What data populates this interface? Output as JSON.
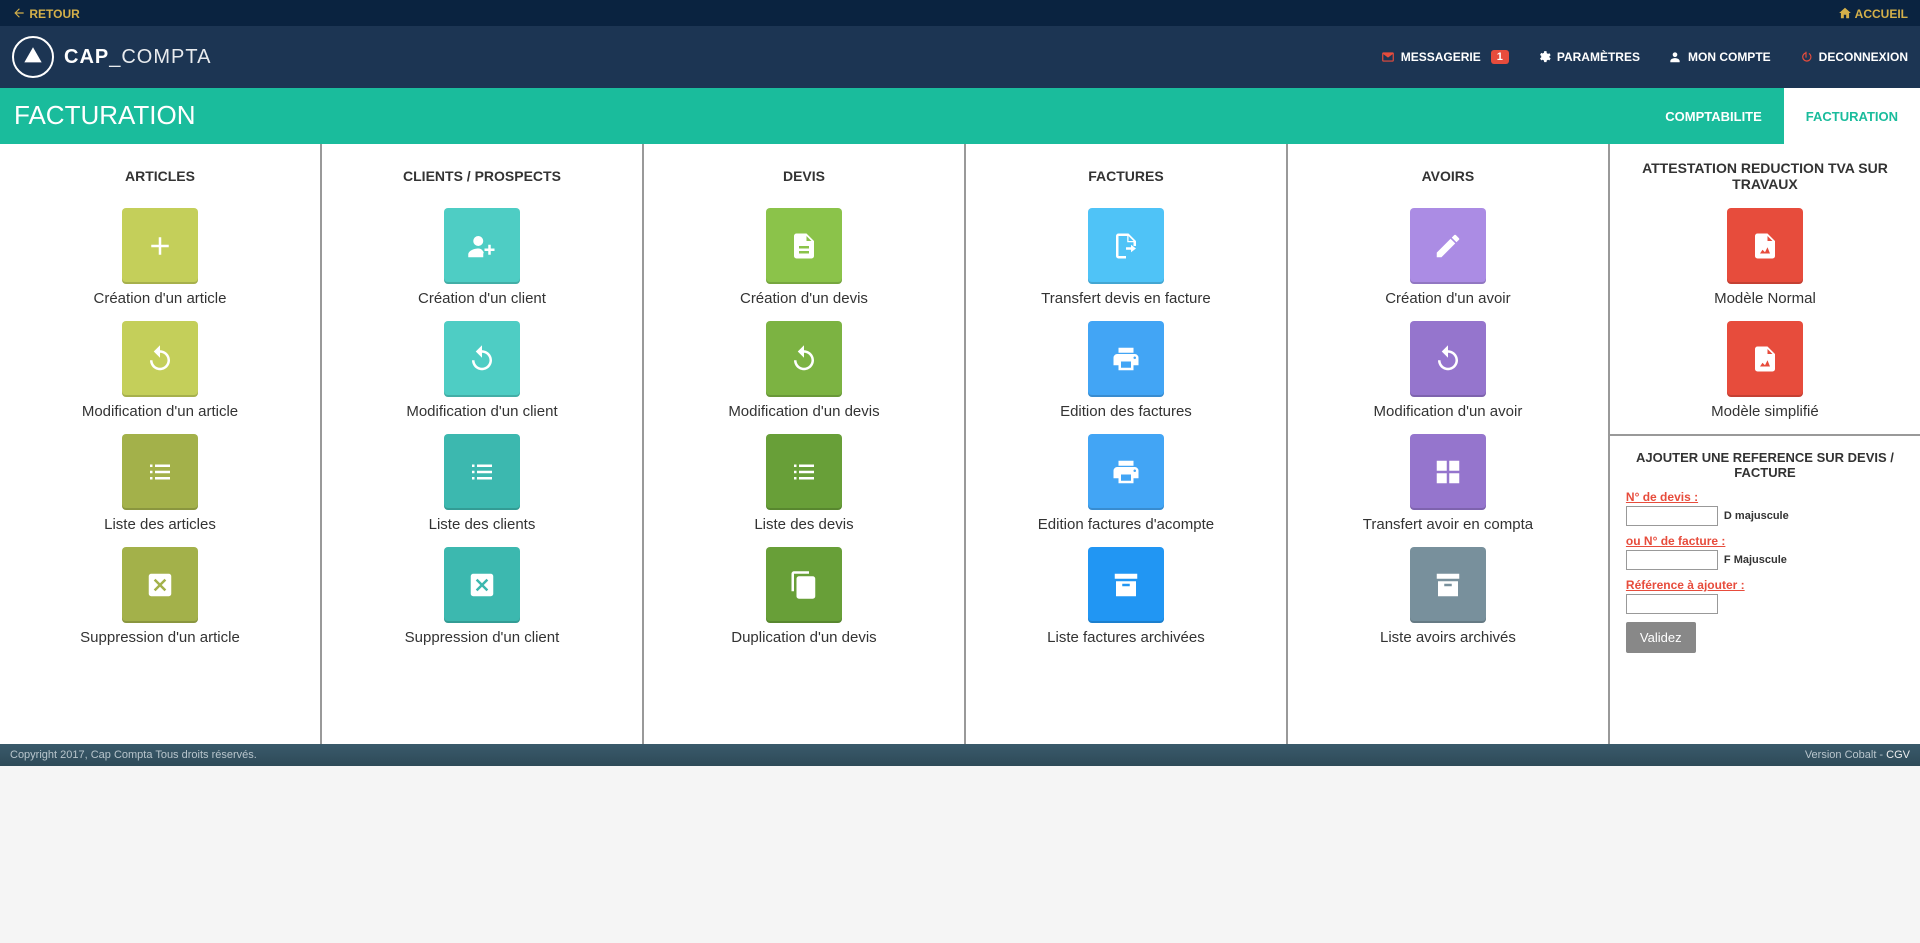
{
  "topbar": {
    "retour": "RETOUR",
    "accueil": "ACCUEIL"
  },
  "brand": {
    "bold": "CAP",
    "light": "_COMPTA"
  },
  "nav": {
    "messagerie": "MESSAGERIE",
    "messagerie_badge": "1",
    "parametres": "PARAMÈTRES",
    "mon_compte": "MON COMPTE",
    "deconnexion": "DECONNEXION"
  },
  "greenbar": {
    "title": "FACTURATION",
    "tab_compta": "COMPTABILITE",
    "tab_fact": "FACTURATION"
  },
  "columns": {
    "articles": {
      "title": "ARTICLES",
      "create": "Création d'un article",
      "modify": "Modification d'un article",
      "list": "Liste des articles",
      "delete": "Suppression d'un article"
    },
    "clients": {
      "title": "CLIENTS / PROSPECTS",
      "create": "Création d'un client",
      "modify": "Modification d'un client",
      "list": "Liste des clients",
      "delete": "Suppression d'un client"
    },
    "devis": {
      "title": "DEVIS",
      "create": "Création d'un devis",
      "modify": "Modification d'un devis",
      "list": "Liste des devis",
      "dup": "Duplication d'un devis"
    },
    "factures": {
      "title": "FACTURES",
      "transfer": "Transfert devis en facture",
      "edit": "Edition des factures",
      "acompte": "Edition factures d'acompte",
      "archive": "Liste factures archivées"
    },
    "avoirs": {
      "title": "AVOIRS",
      "create": "Création d'un avoir",
      "modify": "Modification d'un avoir",
      "transfer": "Transfert avoir en compta",
      "archive": "Liste avoirs archivés"
    },
    "attestation": {
      "title": "ATTESTATION REDUCTION TVA SUR TRAVAUX",
      "normal": "Modèle Normal",
      "simple": "Modèle simplifié"
    }
  },
  "refpanel": {
    "title": "AJOUTER UNE REFERENCE SUR DEVIS / FACTURE",
    "label_devis": "N° de devis :",
    "hint_devis": "D majuscule",
    "label_facture": "ou N° de facture :",
    "hint_facture": "F Majuscule",
    "label_ref": "Référence à ajouter :",
    "validate": "Validez"
  },
  "footer": {
    "copyright": "Copyright 2017, Cap Compta Tous droits réservés.",
    "version": "Version Cobalt - ",
    "cgv": "CGV"
  }
}
